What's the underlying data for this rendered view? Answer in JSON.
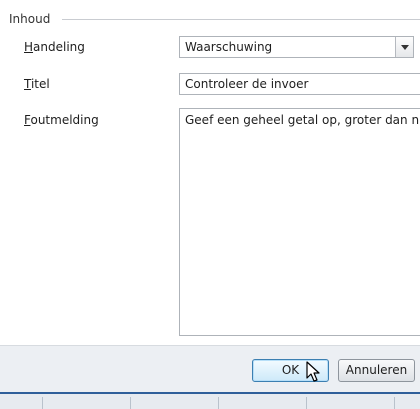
{
  "group": {
    "title": "Inhoud"
  },
  "fields": {
    "handeling": {
      "label_underlined": "H",
      "label_rest": "andeling",
      "value": "Waarschuwing"
    },
    "titel": {
      "label_underlined": "T",
      "label_rest": "itel",
      "value": "Controleer de invoer"
    },
    "foutmelding": {
      "label_underlined": "F",
      "label_rest": "outmelding",
      "value": "Geef een geheel getal op, groter dan nul"
    }
  },
  "buttons": {
    "ok": "OK",
    "cancel": "Annuleren"
  },
  "icons": {
    "dropdown": "chevron-down-icon",
    "cursor": "mouse-pointer-icon"
  }
}
